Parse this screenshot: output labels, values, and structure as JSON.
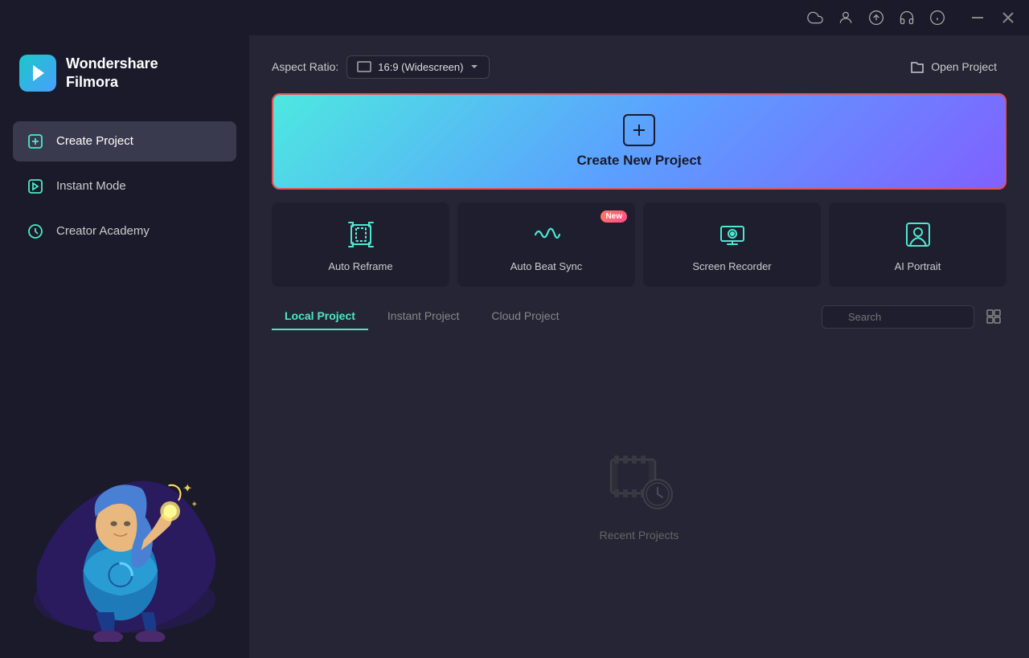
{
  "titlebar": {
    "icons": [
      "cloud",
      "user",
      "upload",
      "headphone",
      "info",
      "minimize",
      "close"
    ]
  },
  "logo": {
    "text": "Wondershare\nFilmora"
  },
  "sidebar": {
    "items": [
      {
        "id": "create-project",
        "label": "Create Project",
        "active": true
      },
      {
        "id": "instant-mode",
        "label": "Instant Mode",
        "active": false
      },
      {
        "id": "creator-academy",
        "label": "Creator Academy",
        "active": false
      }
    ]
  },
  "toolbar": {
    "aspect_ratio_label": "Aspect Ratio:",
    "aspect_ratio_value": "16:9 (Widescreen)",
    "open_project_label": "Open Project"
  },
  "banner": {
    "label": "Create New Project"
  },
  "features": [
    {
      "id": "auto-reframe",
      "label": "Auto Reframe",
      "new": false
    },
    {
      "id": "auto-beat-sync",
      "label": "Auto Beat Sync",
      "new": true
    },
    {
      "id": "screen-recorder",
      "label": "Screen Recorder",
      "new": false
    },
    {
      "id": "ai-portrait",
      "label": "AI Portrait",
      "new": false
    }
  ],
  "project_tabs": [
    {
      "id": "local",
      "label": "Local Project",
      "active": true
    },
    {
      "id": "instant",
      "label": "Instant Project",
      "active": false
    },
    {
      "id": "cloud",
      "label": "Cloud Project",
      "active": false
    }
  ],
  "search": {
    "placeholder": "Search"
  },
  "empty_state": {
    "text": "Recent Projects"
  },
  "badges": {
    "new": "New"
  }
}
